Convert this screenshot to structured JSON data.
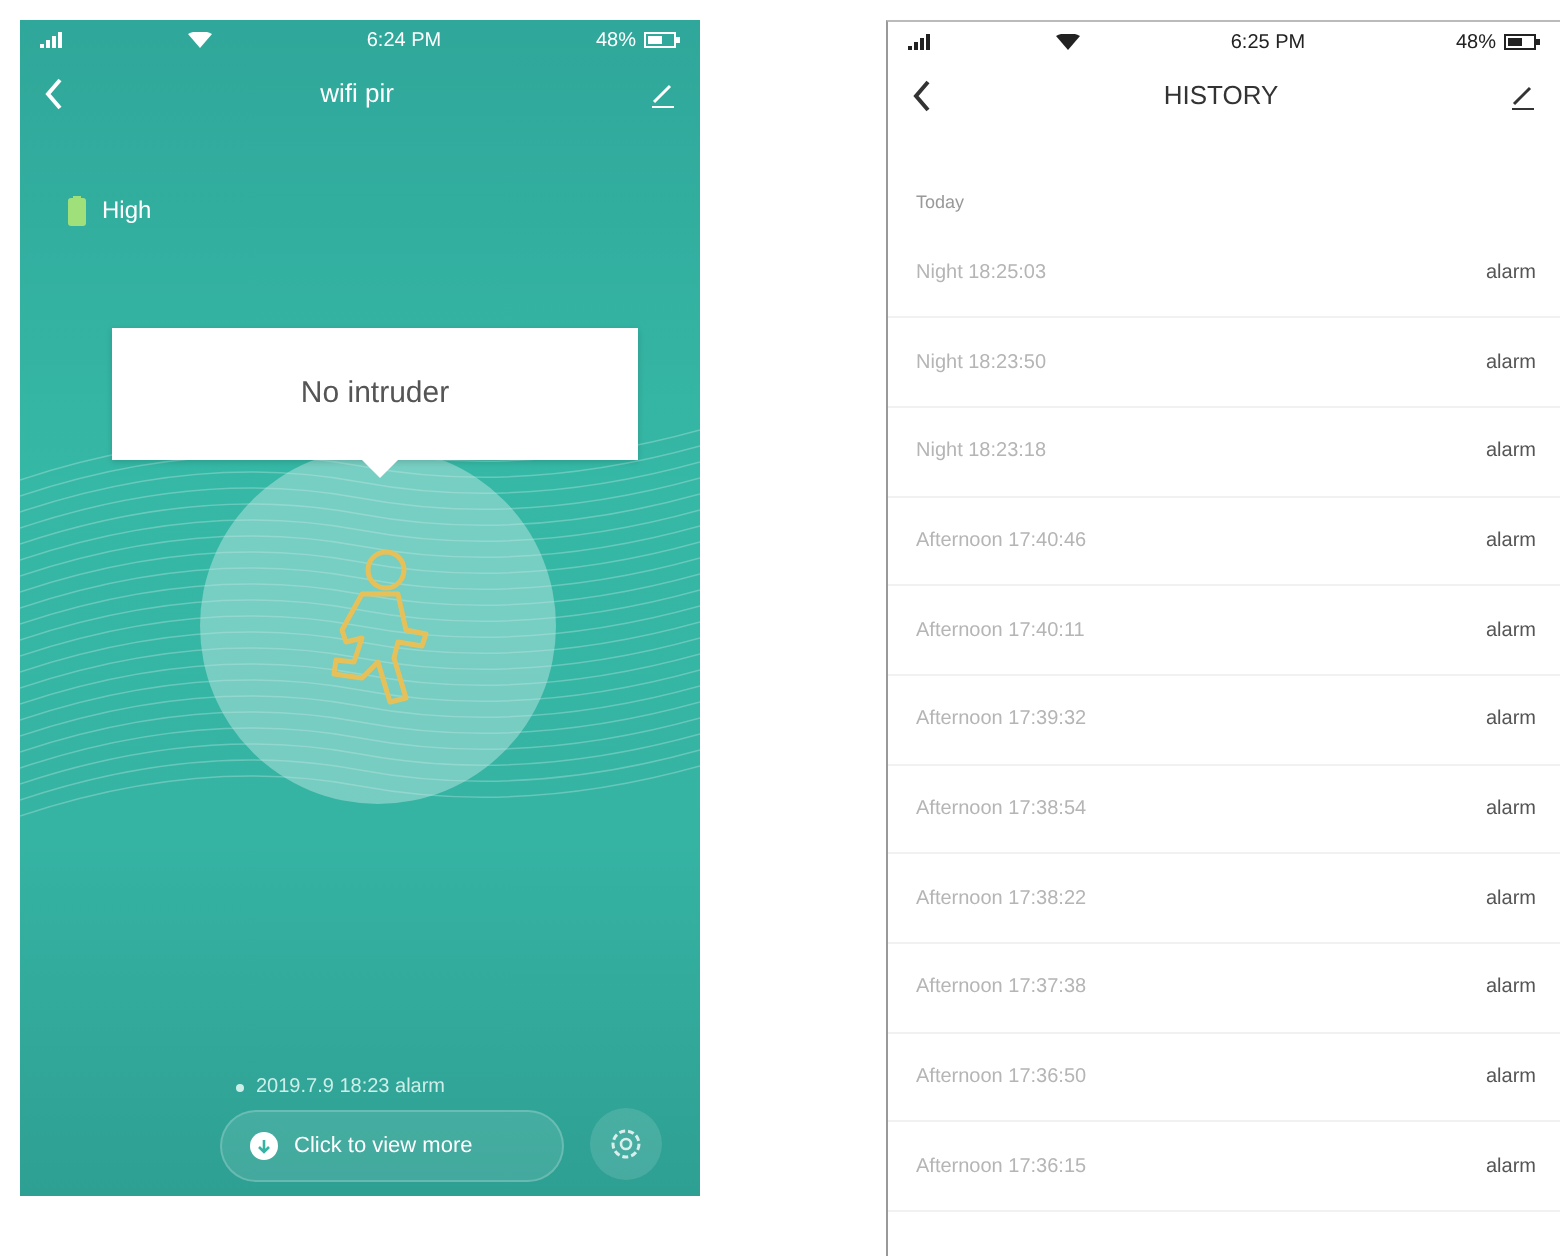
{
  "device_screen": {
    "status_bar": {
      "time": "6:24 PM",
      "battery": "48%"
    },
    "title": "wifi pir",
    "battery_level": "High",
    "status_message": "No intruder",
    "last_event": "2019.7.9 18:23 alarm",
    "more_button": "Click to view more"
  },
  "history_screen": {
    "status_bar": {
      "time": "6:25 PM",
      "battery": "48%"
    },
    "title": "HISTORY",
    "section": "Today",
    "rows": [
      {
        "time": "Night 18:25:03",
        "event": "alarm"
      },
      {
        "time": "Night 18:23:50",
        "event": "alarm"
      },
      {
        "time": "Night 18:23:18",
        "event": "alarm"
      },
      {
        "time": "Afternoon 17:40:46",
        "event": "alarm"
      },
      {
        "time": "Afternoon 17:40:11",
        "event": "alarm"
      },
      {
        "time": "Afternoon 17:39:32",
        "event": "alarm"
      },
      {
        "time": "Afternoon 17:38:54",
        "event": "alarm"
      },
      {
        "time": "Afternoon 17:38:22",
        "event": "alarm"
      },
      {
        "time": "Afternoon 17:37:38",
        "event": "alarm"
      },
      {
        "time": "Afternoon 17:36:50",
        "event": "alarm"
      },
      {
        "time": "Afternoon 17:36:15",
        "event": "alarm"
      }
    ]
  }
}
